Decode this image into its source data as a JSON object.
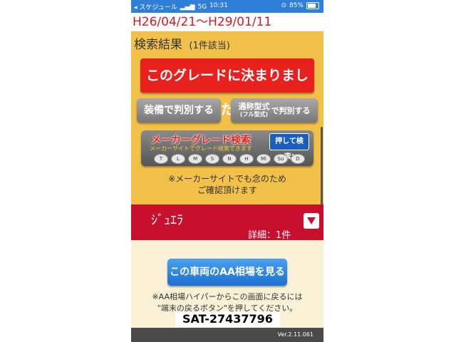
{
  "status_bar": {
    "carrier": "◂ スケジュール",
    "network": "5G",
    "time": "10:31",
    "battery_percent": "85%"
  },
  "date_range": "H26/04/21～H29/01/11",
  "search_results": {
    "title": "検索結果",
    "count": "(1件該当)"
  },
  "buttons": {
    "decide_grade": "このグレードに決まりました",
    "by_equipment": "装備で判別する",
    "by_model_main": "通称型式",
    "by_model_sub": "(フル型式)",
    "by_model_suffix": "で判別する",
    "aa_price": "この車両のAA相場を見る"
  },
  "maker_banner": {
    "title": "メーカーグレード検索",
    "subtitle": "メーカーサイトでグレード検索できます",
    "push": "押して検索!",
    "logos": [
      "T",
      "L",
      "M",
      "S",
      "N",
      "H",
      "Mi",
      "Su",
      "D"
    ]
  },
  "note_maker": [
    "※メーカーサイトでも念のため",
    "ご確認頂けます"
  ],
  "grade": {
    "name": "ｼﾞｭｴﾗ",
    "detail": "詳細：1件"
  },
  "note_back": [
    "※AA相場ハイパーからこの画面に戻るには",
    "\"端末の戻るボタン\"を押してください。"
  ],
  "watermark": "SAT-27437796",
  "version": "Ver.2.11.061",
  "colors": {
    "accent_red": "#e8201e",
    "status_blue": "#2f7fd6",
    "background_yellow": "#f2c14a",
    "grade_bar": "#c8102e"
  }
}
